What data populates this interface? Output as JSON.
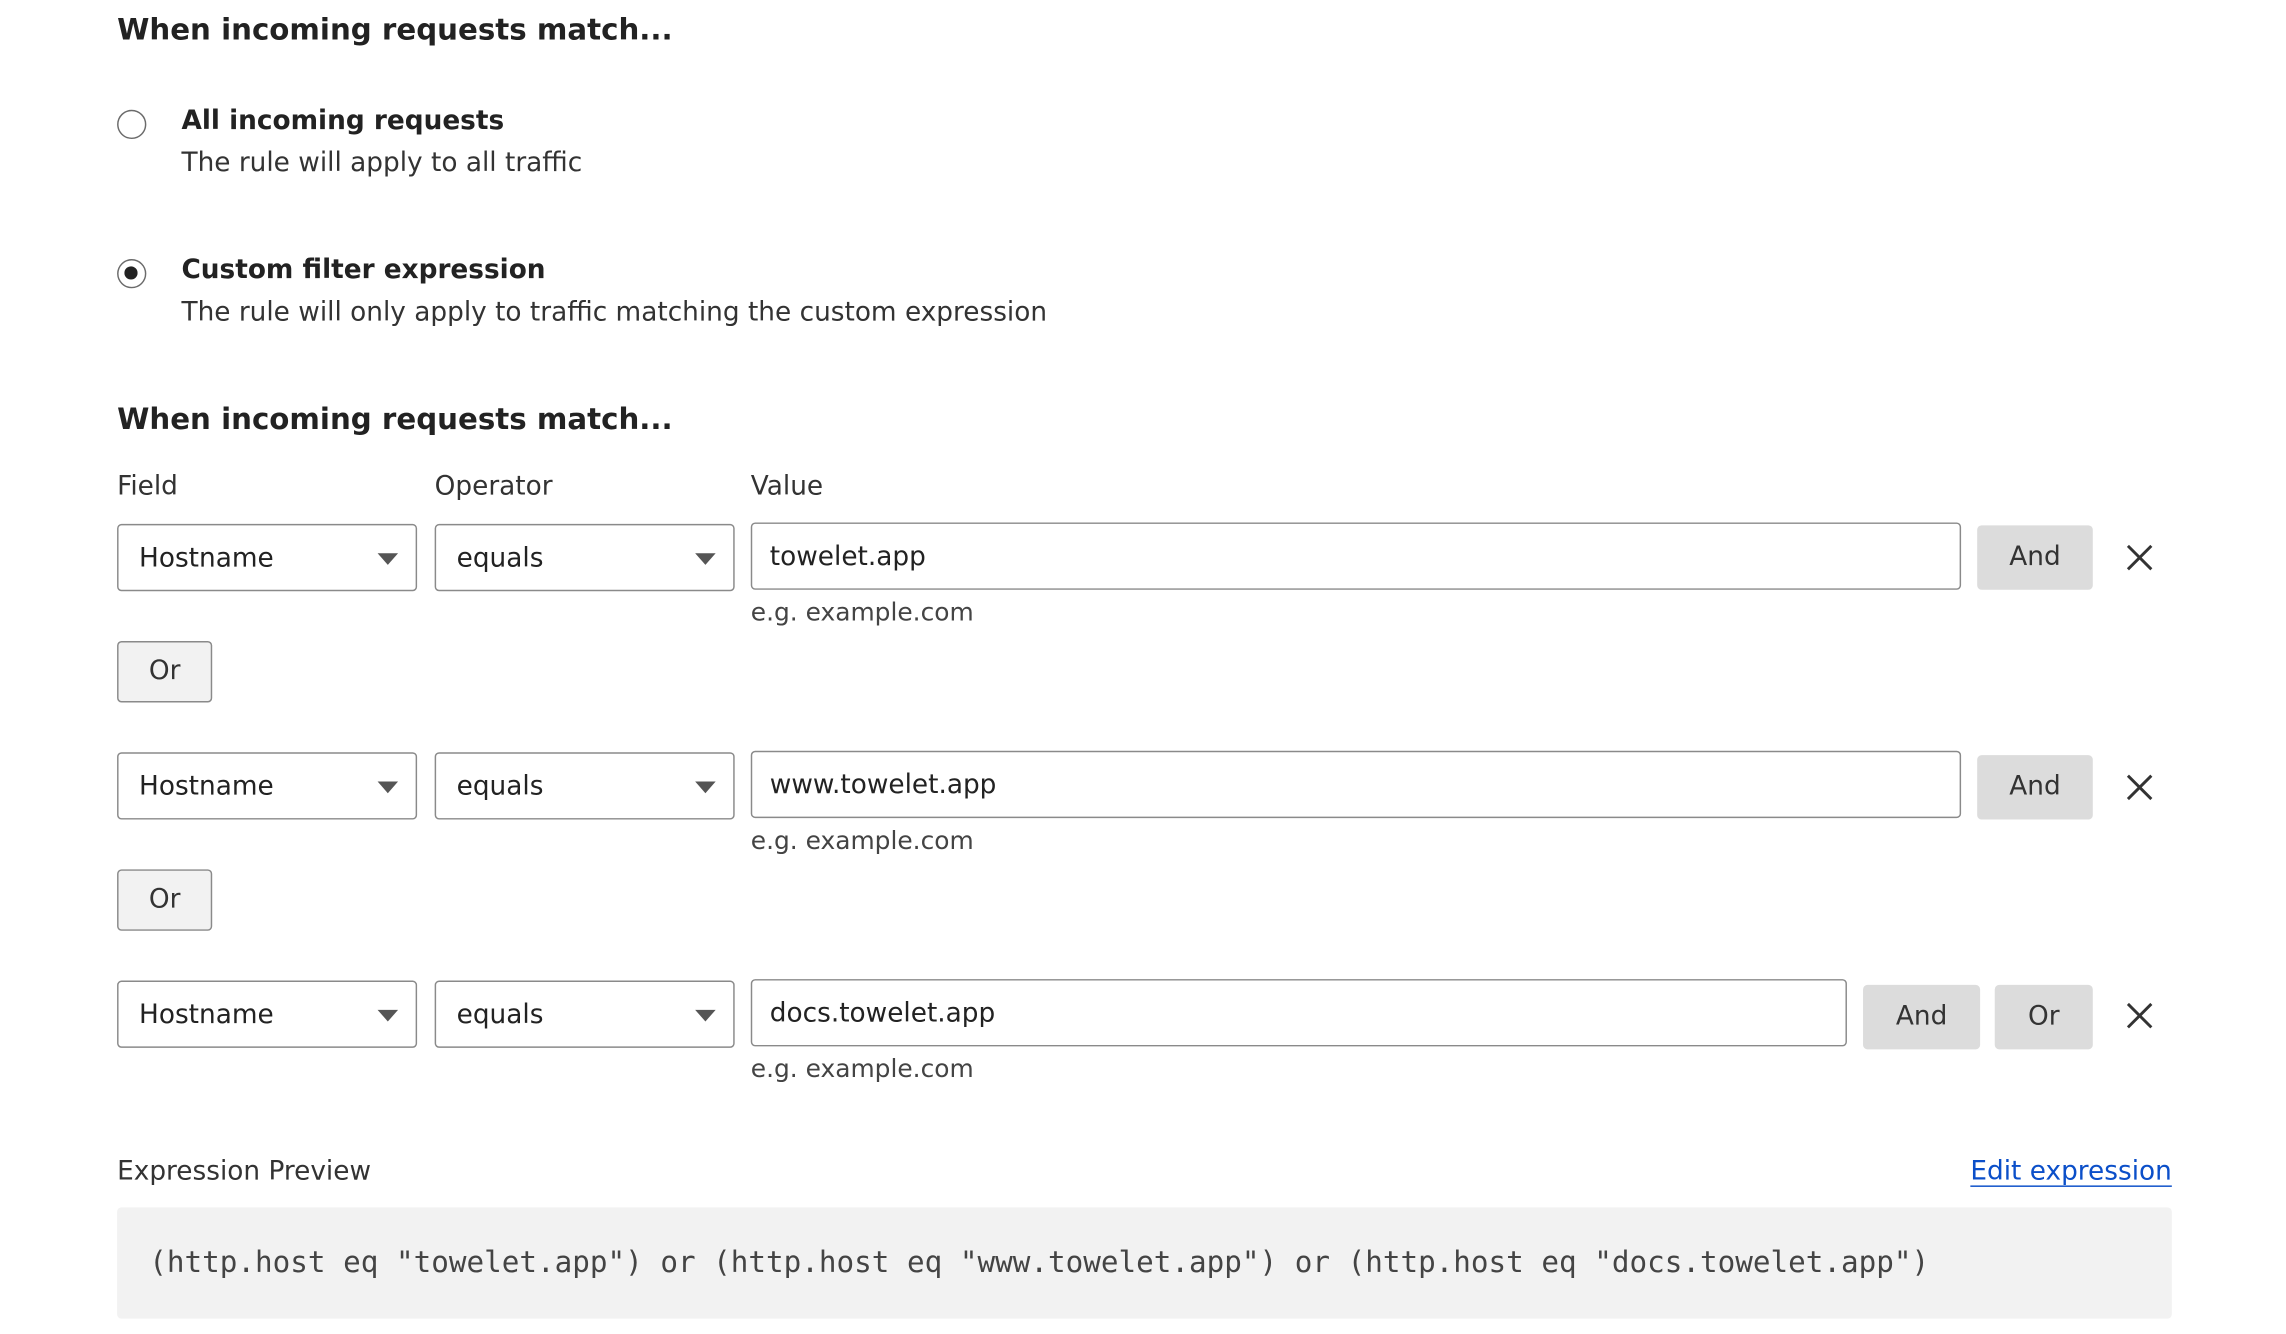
{
  "sections": {
    "top_heading": "When incoming requests match...",
    "filter_heading": "When incoming requests match..."
  },
  "options": {
    "all": {
      "title": "All incoming requests",
      "description": "The rule will apply to all traffic",
      "selected": false
    },
    "custom": {
      "title": "Custom filter expression",
      "description": "The rule will only apply to traffic matching the custom expression",
      "selected": true
    }
  },
  "columns": {
    "field": "Field",
    "operator": "Operator",
    "value": "Value"
  },
  "rules": [
    {
      "field": "Hostname",
      "operator": "equals",
      "value": "towelet.app",
      "hint": "e.g. example.com",
      "and_label": "And"
    },
    {
      "field": "Hostname",
      "operator": "equals",
      "value": "www.towelet.app",
      "hint": "e.g. example.com",
      "and_label": "And"
    },
    {
      "field": "Hostname",
      "operator": "equals",
      "value": "docs.towelet.app",
      "hint": "e.g. example.com",
      "and_label": "And",
      "or_label": "Or"
    }
  ],
  "or_buttons": [
    "Or",
    "Or"
  ],
  "preview": {
    "label": "Expression Preview",
    "edit_link": "Edit expression",
    "expression": "(http.host eq \"towelet.app\") or (http.host eq \"www.towelet.app\") or (http.host eq \"docs.towelet.app\")"
  },
  "colors": {
    "link": "#0b4fc9",
    "button_gray": "#dcdcdc",
    "code_background": "#f2f2f2"
  },
  "icons": {
    "remove": "close-icon",
    "dropdown": "chevron-down-icon"
  }
}
